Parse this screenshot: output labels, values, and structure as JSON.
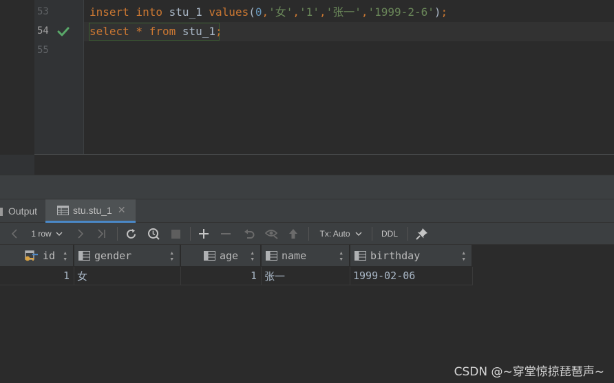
{
  "editor": {
    "line_numbers": [
      "53",
      "54",
      "55"
    ],
    "line53": {
      "kw1": "insert into",
      "t1": " stu_1 ",
      "kw2": "values",
      "p1": "(",
      "n1": "0",
      "c1": ",",
      "s1": "'女'",
      "c2": ",",
      "s2": "'1'",
      "c3": ",",
      "s3": "'张一'",
      "c4": ",",
      "s4": "'1999-2-6'",
      "p2": ")",
      "semi": ";"
    },
    "line54": {
      "kw1": "select",
      "star": " * ",
      "kw2": "from",
      "t1": " stu_1",
      "semi": ";"
    }
  },
  "tabs": {
    "output": "Output",
    "result": "stu.stu_1",
    "close": "✕"
  },
  "toolbar": {
    "row_count": "1 row",
    "tx": "Tx: Auto",
    "ddl": "DDL"
  },
  "grid": {
    "columns": [
      "id",
      "gender",
      "age",
      "name",
      "birthday"
    ],
    "rows": [
      {
        "row_num": "1",
        "id": "1",
        "gender": "女",
        "age": "1",
        "name": "张一",
        "birthday": "1999-02-06"
      }
    ]
  },
  "watermark": "CSDN @~穿堂惊掠琵琶声~",
  "colors": {
    "keyword": "#cc7832",
    "string": "#6a8759",
    "number": "#6897bb",
    "check": "#59a869",
    "accent": "#4a88c7"
  },
  "icons": [
    "check-icon",
    "table-icon",
    "nav-first-icon",
    "nav-prev-icon",
    "nav-next-icon",
    "nav-last-icon",
    "refresh-icon",
    "history-icon",
    "stop-icon",
    "add-row-icon",
    "delete-row-icon",
    "revert-icon",
    "preview-icon",
    "submit-icon",
    "pin-icon",
    "key-column-icon",
    "column-icon"
  ]
}
